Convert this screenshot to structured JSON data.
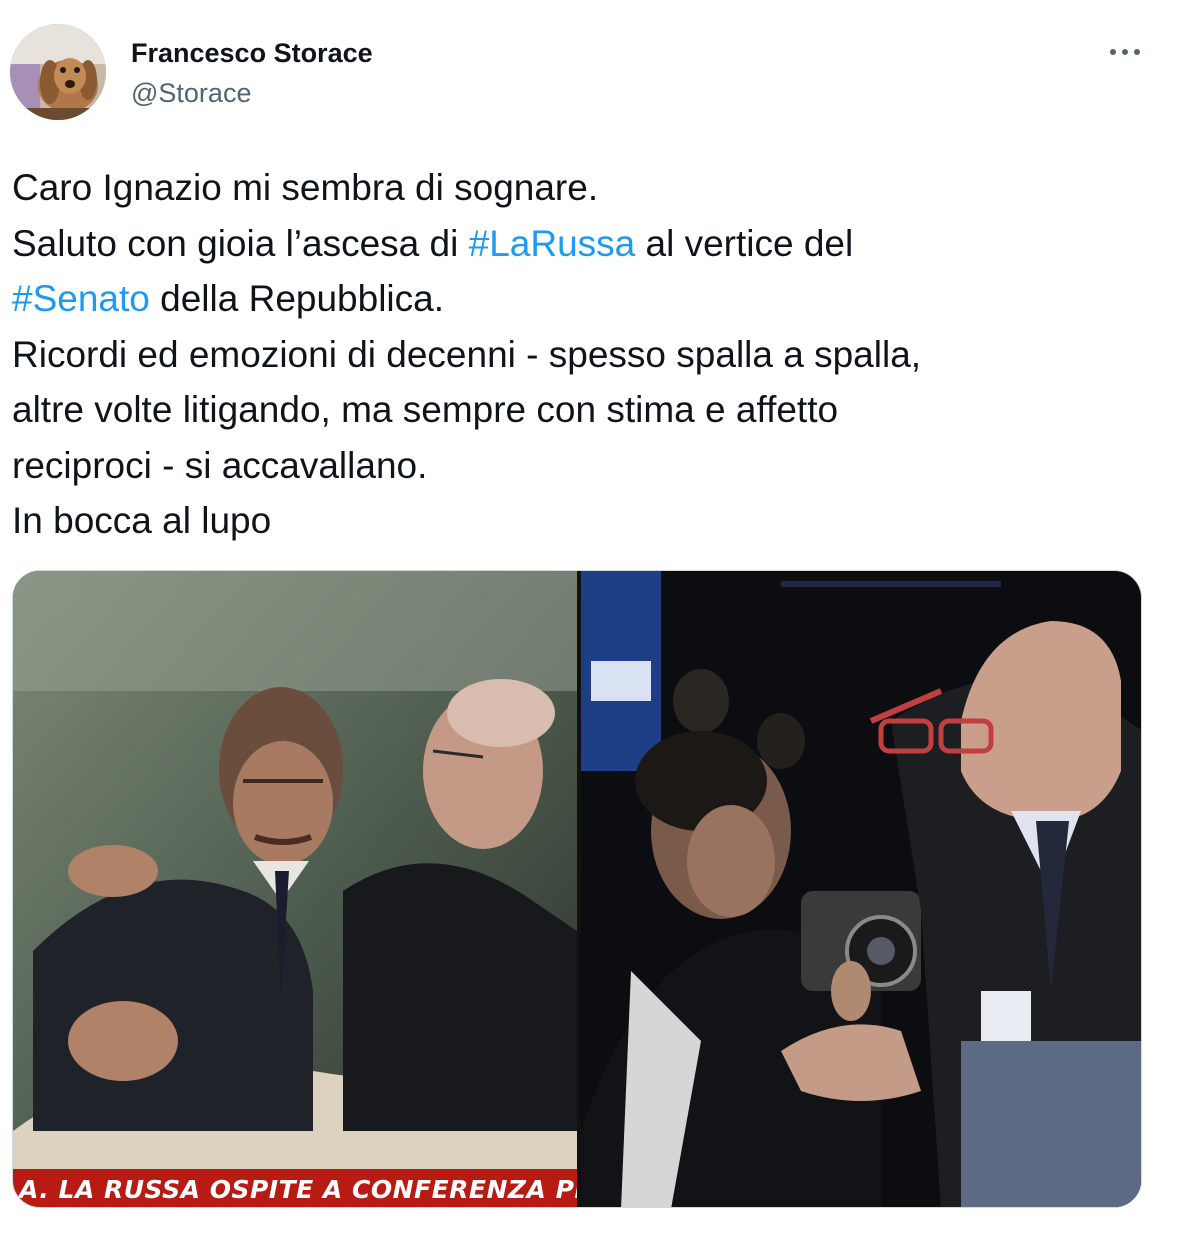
{
  "author": {
    "display_name": "Francesco Storace",
    "handle": "@Storace",
    "avatar_icon": "dog-avatar-icon"
  },
  "more_icon": "more-options-icon",
  "tweet": {
    "lines": [
      [
        {
          "text": "Caro Ignazio mi sembra di sognare.",
          "tag": false
        }
      ],
      [
        {
          "text": "Saluto con gioia l’ascesa di ",
          "tag": false
        },
        {
          "text": "#LaRussa",
          "tag": true
        },
        {
          "text": " al vertice del",
          "tag": false
        }
      ],
      [
        {
          "text": "#Senato",
          "tag": true
        },
        {
          "text": " della Repubblica.",
          "tag": false
        }
      ],
      [
        {
          "text": "Ricordi ed emozioni di decenni - spesso spalla a spalla,",
          "tag": false
        }
      ],
      [
        {
          "text": "altre volte litigando, ma sempre con stima e affetto",
          "tag": false
        }
      ],
      [
        {
          "text": "reciproci - si accavallano.",
          "tag": false
        }
      ],
      [
        {
          "text": "In bocca al lupo",
          "tag": false
        }
      ]
    ]
  },
  "media": {
    "left_caption": "A. LA RUSSA OSPITE A CONFERENZA PROGRA",
    "left_banner_color": "#b81b14"
  },
  "colors": {
    "hashtag": "#1d9bf0",
    "secondary_text": "#536471",
    "border": "#cfd9de"
  }
}
